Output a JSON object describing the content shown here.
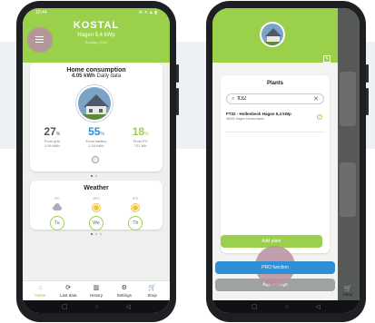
{
  "phone1": {
    "status": {
      "time": "10:44",
      "icons": "✉ ✦ ▲ ▮"
    },
    "brand": "KOSTAL",
    "plant_name": "Hagen 5,4 kWp",
    "date": "Sunday, 2024",
    "home_consumption": {
      "title": "Home consumption",
      "daily": "4.05 kWh",
      "daily_label": "Daily data",
      "stats": [
        {
          "value": "27",
          "unit": "%",
          "label": "From grid",
          "kwh": "1.09 kWh",
          "color": "#555555"
        },
        {
          "value": "55",
          "unit": "%",
          "label": "From battery",
          "kwh": "2.24 kWh",
          "color": "#2f8fd6"
        },
        {
          "value": "18",
          "unit": "%",
          "label": "From PV",
          "kwh": "721 Wh",
          "color": "#9bd14a"
        }
      ]
    },
    "weather": {
      "title": "Weather",
      "days": [
        {
          "temp": "4°C",
          "icon": "cloud-icon",
          "day": "Tu"
        },
        {
          "temp": "15°C",
          "icon": "sun-icon",
          "day": "We"
        },
        {
          "temp": "6°C",
          "icon": "sun-icon",
          "day": "Th"
        }
      ]
    },
    "tabs": [
      {
        "label": "Home",
        "icon": "⌂",
        "active": true
      },
      {
        "label": "Last data",
        "icon": "⟳",
        "active": false
      },
      {
        "label": "History",
        "icon": "▥",
        "active": false
      },
      {
        "label": "Settings",
        "icon": "⚙",
        "active": false
      },
      {
        "label": "Shop",
        "icon": "🛒",
        "active": false
      }
    ],
    "nav": [
      "▢",
      "○",
      "◁"
    ]
  },
  "phone2": {
    "plants": {
      "title": "Plants",
      "search_value": "ft32",
      "results": [
        {
          "name": "FT32 - Hollenbeck Hagen 5,4 kWp",
          "address": "58093 Hagen Deutschland"
        }
      ]
    },
    "add_plant": "Add plant",
    "pro_function": "PRO function",
    "app_settings": "App settings",
    "shop_label": "Shop",
    "nav": [
      "▢",
      "○",
      "◁"
    ]
  },
  "colors": {
    "accent_green": "#9bd14a",
    "accent_blue": "#2f8fd6",
    "highlight": "#b88fa0"
  }
}
